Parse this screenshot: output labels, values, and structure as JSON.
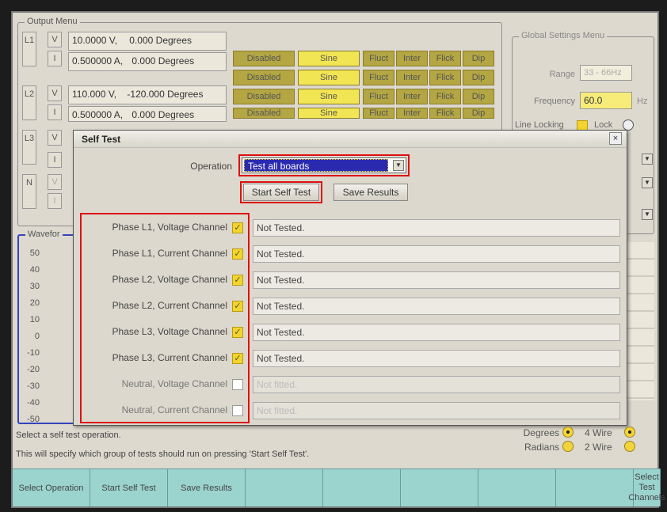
{
  "output_menu": {
    "title": "Output Menu",
    "phases": [
      {
        "name": "L1",
        "v": {
          "tag": "V",
          "value": "10.0000 V,",
          "angle": "0.000 Degrees"
        },
        "i": {
          "tag": "I",
          "value": "0.500000 A,",
          "angle": "0.000 Degrees"
        }
      },
      {
        "name": "L2",
        "v": {
          "tag": "V",
          "value": "110.000 V,",
          "angle": "-120.000 Degrees"
        },
        "i": {
          "tag": "I",
          "value": "0.500000 A,",
          "angle": "0.000 Degrees"
        }
      },
      {
        "name": "L3",
        "v": {
          "tag": "V"
        },
        "i": {
          "tag": "I"
        }
      },
      {
        "name": "N",
        "v": {
          "tag": "V"
        },
        "i": {
          "tag": "I"
        }
      }
    ],
    "row_buttons": {
      "disabled": "Disabled",
      "sine": "Sine",
      "fluct": "Fluct",
      "inter": "Inter",
      "flick": "Flick",
      "dip": "Dip"
    }
  },
  "global_settings": {
    "title": "Global Settings Menu",
    "range_label": "Range",
    "range_value": "33 - 66Hz",
    "frequency_label": "Frequency",
    "frequency_value": "60.0",
    "frequency_unit": "Hz",
    "line_locking_label": "Line Locking",
    "lock_label": "Lock"
  },
  "waveform": {
    "title": "Wavefor",
    "y_ticks": [
      "50",
      "40",
      "30",
      "20",
      "10",
      "0",
      "-10",
      "-20",
      "-30",
      "-40",
      "-50"
    ]
  },
  "dialog": {
    "title": "Self Test",
    "close": "×",
    "operation_label": "Operation",
    "operation_value": "Test all boards",
    "start_button": "Start Self Test",
    "save_button": "Save Results",
    "channels": [
      {
        "label": "Phase L1, Voltage Channel",
        "checked": true,
        "status": "Not Tested."
      },
      {
        "label": "Phase L1, Current Channel",
        "checked": true,
        "status": "Not Tested."
      },
      {
        "label": "Phase L2, Voltage Channel",
        "checked": true,
        "status": "Not Tested."
      },
      {
        "label": "Phase L2, Current Channel",
        "checked": true,
        "status": "Not Tested."
      },
      {
        "label": "Phase L3, Voltage Channel",
        "checked": true,
        "status": "Not Tested."
      },
      {
        "label": "Phase L3, Current Channel",
        "checked": true,
        "status": "Not Tested."
      },
      {
        "label": "Neutral, Voltage Channel",
        "checked": false,
        "status": "Not fitted."
      },
      {
        "label": "Neutral, Current Channel",
        "checked": false,
        "status": "Not fitted."
      }
    ]
  },
  "units": {
    "degrees_label": "Degrees",
    "radians_label": "Radians",
    "wire4_label": "4 Wire",
    "wire2_label": "2 Wire"
  },
  "help": {
    "line1": "Select a self test operation.",
    "line2": "This will specify which group of tests should run on pressing 'Start Self Test'."
  },
  "softkeys": [
    "Select Operation",
    "Start Self Test",
    "Save Results",
    "",
    "",
    "",
    "",
    "",
    "Select Test Channels"
  ],
  "colors": {
    "softkey_bg": "#9bd4cf",
    "button_yellow": "#f2e553",
    "button_dark_yellow": "#b3a643",
    "highlight_red": "#dd1111",
    "selection_blue": "#2a2ab0"
  }
}
